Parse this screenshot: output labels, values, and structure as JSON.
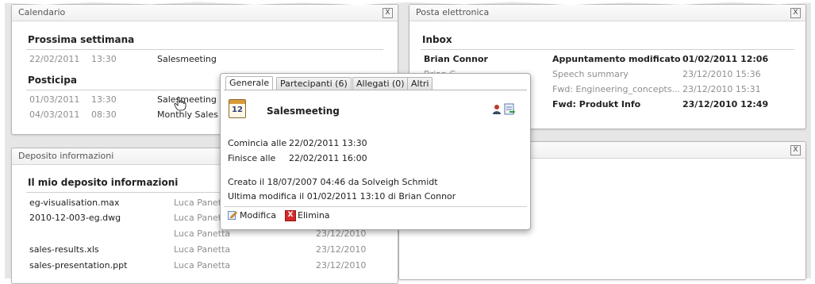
{
  "calendar": {
    "title": "Calendario",
    "close": "X",
    "next_week_label": "Prossima settimana",
    "next_week_rows": [
      {
        "date": "22/02/2011",
        "time": "13:30",
        "subject": "Salesmeeting"
      }
    ],
    "postponed_label": "Posticipa",
    "postponed_rows": [
      {
        "date": "01/03/2011",
        "time": "13:30",
        "subject": "Salesmeeting"
      },
      {
        "date": "04/03/2011",
        "time": "08:30",
        "subject": "Monthly Sales"
      }
    ]
  },
  "email": {
    "title": "Posta elettronica",
    "close": "X",
    "inbox_label": "Inbox",
    "rows": [
      {
        "from": "Brian Connor",
        "subject": "Appuntamento modificato",
        "date": "01/02/2011 12:06",
        "unread": true
      },
      {
        "from": "Brian C...",
        "subject": "Speech summary",
        "date": "23/12/2010 15:36",
        "unread": false
      },
      {
        "from": "",
        "subject": "Fwd: Engineering_concepts...",
        "date": "23/12/2010 15:31",
        "unread": false
      },
      {
        "from": "",
        "subject": "Fwd: Produkt Info",
        "date": "23/12/2010 12:49",
        "unread": true
      }
    ]
  },
  "deposit": {
    "title": "Deposito informazioni",
    "heading": "Il mio deposito informazioni",
    "rows": [
      {
        "file": "eg-visualisation.max",
        "owner": "Luca Panetta",
        "date": ""
      },
      {
        "file": "2010-12-003-eg.dwg",
        "owner": "Luca Panetta",
        "date": ""
      },
      {
        "file": "",
        "owner": "Luca Panetta",
        "date": "23/12/2010"
      },
      {
        "file": "sales-results.xls",
        "owner": "Luca Panetta",
        "date": "23/12/2010"
      },
      {
        "file": "sales-presentation.ppt",
        "owner": "Luca Panetta",
        "date": "23/12/2010"
      }
    ]
  },
  "third_panel": {
    "close": "X"
  },
  "popup": {
    "tabs": [
      "Generale",
      "Partecipanti (6)",
      "Allegati (0)",
      "Altri"
    ],
    "calendar_icon_day": "12",
    "subject": "Salesmeeting",
    "start_label": "Comincia alle",
    "start_value": "22/02/2011 13:30",
    "end_label": "Finisce alle",
    "end_value": "22/02/2011 16:00",
    "created": "Creato il 18/07/2007 04:46 da Solveigh Schmidt",
    "modified": "Ultima modifica il 01/02/2011 13:10 di Brian Connor",
    "edit_label": "Modifica",
    "delete_label": "Elimina",
    "delete_glyph": "X"
  }
}
